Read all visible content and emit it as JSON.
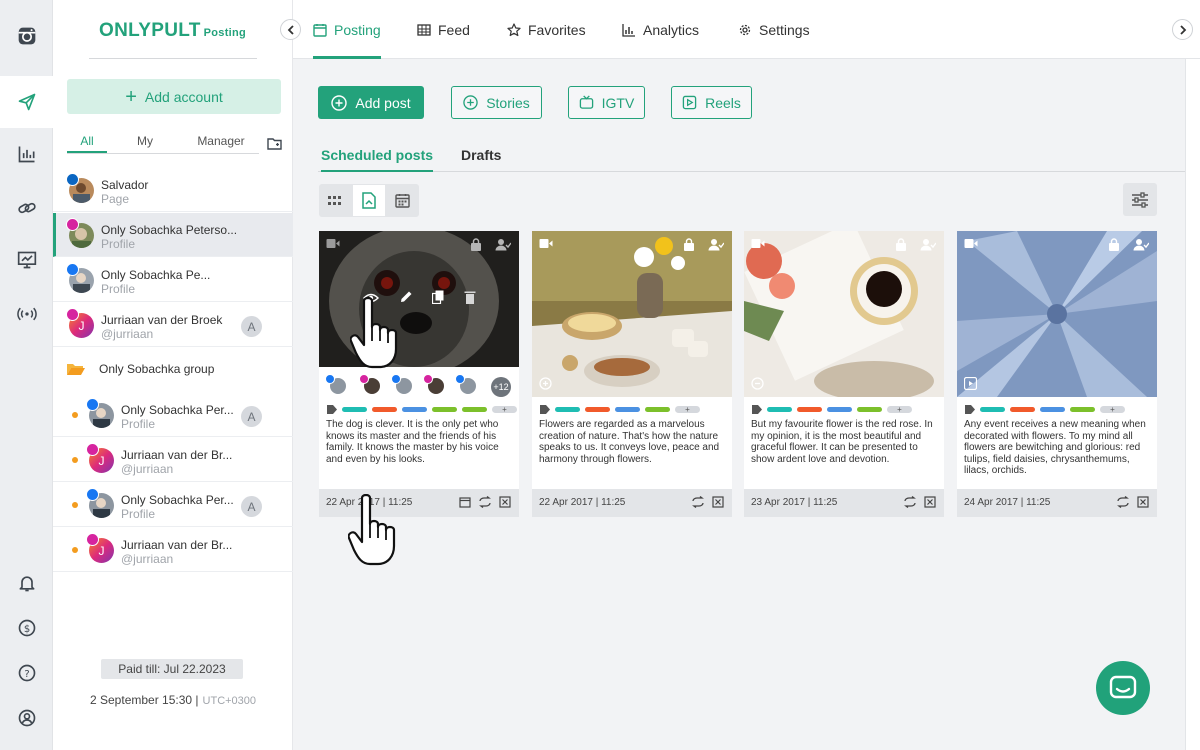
{
  "brand": {
    "name": "ONLYPULT",
    "module": "Posting",
    "accent": "#23a27b"
  },
  "sidebar": {
    "add_account": "Add account",
    "filter_tabs": [
      "All",
      "My",
      "Manager"
    ],
    "accounts": [
      {
        "name": "Salvador",
        "sub": "Page",
        "network": "linkedin"
      },
      {
        "name": "Only Sobachka Peterso...",
        "sub": "Profile",
        "network": "instagram"
      },
      {
        "name": "Only Sobachka Pe...",
        "sub": "Profile",
        "network": "facebook"
      },
      {
        "name": "Jurriaan van der Broek",
        "sub": "@jurriaan",
        "network": "instagram",
        "manager_letter": "A"
      }
    ],
    "group": {
      "name": "Only Sobachka group",
      "accounts": [
        {
          "name": "Only Sobachka Per...",
          "sub": "Profile",
          "network": "facebook",
          "manager_letter": "A"
        },
        {
          "name": "Jurriaan van der Br...",
          "sub": "@jurriaan",
          "network": "instagram"
        },
        {
          "name": "Only Sobachka Per...",
          "sub": "Profile",
          "network": "facebook",
          "manager_letter": "A"
        },
        {
          "name": "Jurriaan van der Br...",
          "sub": "@jurriaan",
          "network": "instagram"
        }
      ]
    },
    "paid_till": "Paid till: Jul 22.2023",
    "datetime": "2 September 15:30 |",
    "timezone": "UTC+0300"
  },
  "topnav": {
    "items": [
      "Posting",
      "Feed",
      "Favorites",
      "Analytics",
      "Settings"
    ],
    "active": "Posting"
  },
  "actions": {
    "add_post": "Add post",
    "stories": "Stories",
    "igtv": "IGTV",
    "reels": "Reels"
  },
  "subtabs": {
    "scheduled": "Scheduled posts",
    "drafts": "Drafts"
  },
  "posts": [
    {
      "date": "22 Apr 2017 | 11:25",
      "text": "The dog is clever. It is the only pet who knows its master and the friends of his family. It knows the master by his voice and even by his looks.",
      "extra_accounts": "+12"
    },
    {
      "date": "22 Apr 2017 | 11:25",
      "text": "Flowers are regarded as a marvelous creation of nature. That's how the nature speaks to us. It conveys love, peace and harmony through flowers."
    },
    {
      "date": "23 Apr 2017 | 11:25",
      "text": "But my favourite flower is the red rose. In my opinion, it is the most beautiful and graceful flower. It can be presented to show ardent love and devotion."
    },
    {
      "date": "24 Apr 2017 | 11:25",
      "text": "Any event receives a new meaning when decorated with flowers. To my mind all flowers are bewitching and glorious: red tulips, field daisies, chrysanthemums, lilacs, orchids."
    }
  ],
  "tag_colors": [
    "#1fbdb3",
    "#f15a2b",
    "#4b91e2",
    "#7cc02b",
    "#7cc02b"
  ],
  "network_colors": {
    "facebook": "#1877f2",
    "instagram": "#d6249f",
    "linkedin": "#0a66c2"
  }
}
